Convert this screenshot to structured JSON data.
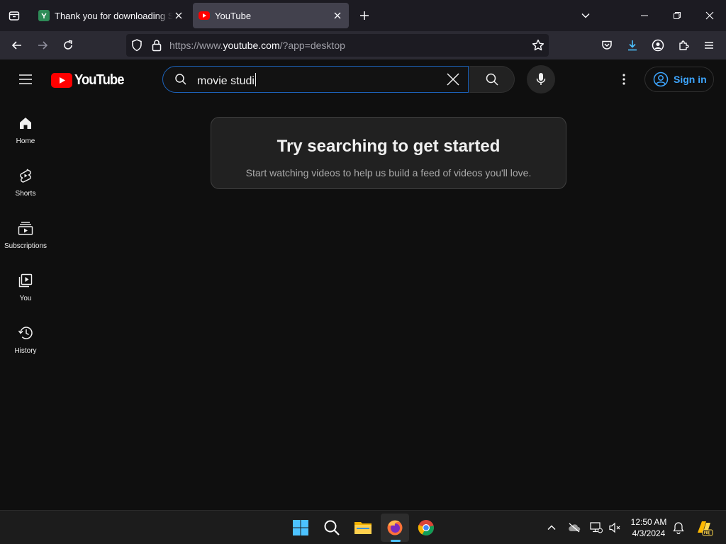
{
  "browser": {
    "tabs": [
      {
        "title": "Thank you for downloading Soft",
        "active": false,
        "favicon_color": "#2e8b57"
      },
      {
        "title": "YouTube",
        "active": true,
        "favicon_color": "#ff0000"
      }
    ],
    "url": {
      "prefix": "https://www.",
      "host": "youtube.com",
      "path": "/?app=desktop"
    },
    "icons": [
      "tab-list-icon",
      "new-tab-icon",
      "list-tabs-icon",
      "minimize-icon",
      "restore-icon",
      "close-window-icon",
      "back-icon",
      "forward-icon",
      "reload-icon",
      "shield-icon",
      "lock-icon",
      "bookmark-star-icon",
      "pocket-icon",
      "downloads-icon",
      "account-icon",
      "extensions-icon",
      "menu-icon"
    ]
  },
  "youtube": {
    "logo_text": "YouTube",
    "search": {
      "query": "movie studi"
    },
    "signin_label": "Sign in",
    "guide": [
      {
        "label": "Home",
        "icon": "home-icon"
      },
      {
        "label": "Shorts",
        "icon": "shorts-icon"
      },
      {
        "label": "Subscriptions",
        "icon": "subscriptions-icon"
      },
      {
        "label": "You",
        "icon": "you-icon"
      },
      {
        "label": "History",
        "icon": "history-icon"
      }
    ],
    "prompt": {
      "title": "Try searching to get started",
      "subtitle": "Start watching videos to help us build a feed of videos you'll love."
    }
  },
  "taskbar": {
    "apps": [
      "windows-start-icon",
      "search-icon",
      "file-explorer-icon",
      "firefox-icon",
      "chrome-icon"
    ],
    "clock": {
      "time": "12:50 AM",
      "date": "4/3/2024"
    },
    "colors": {
      "accent": "#4cc2ff"
    }
  }
}
